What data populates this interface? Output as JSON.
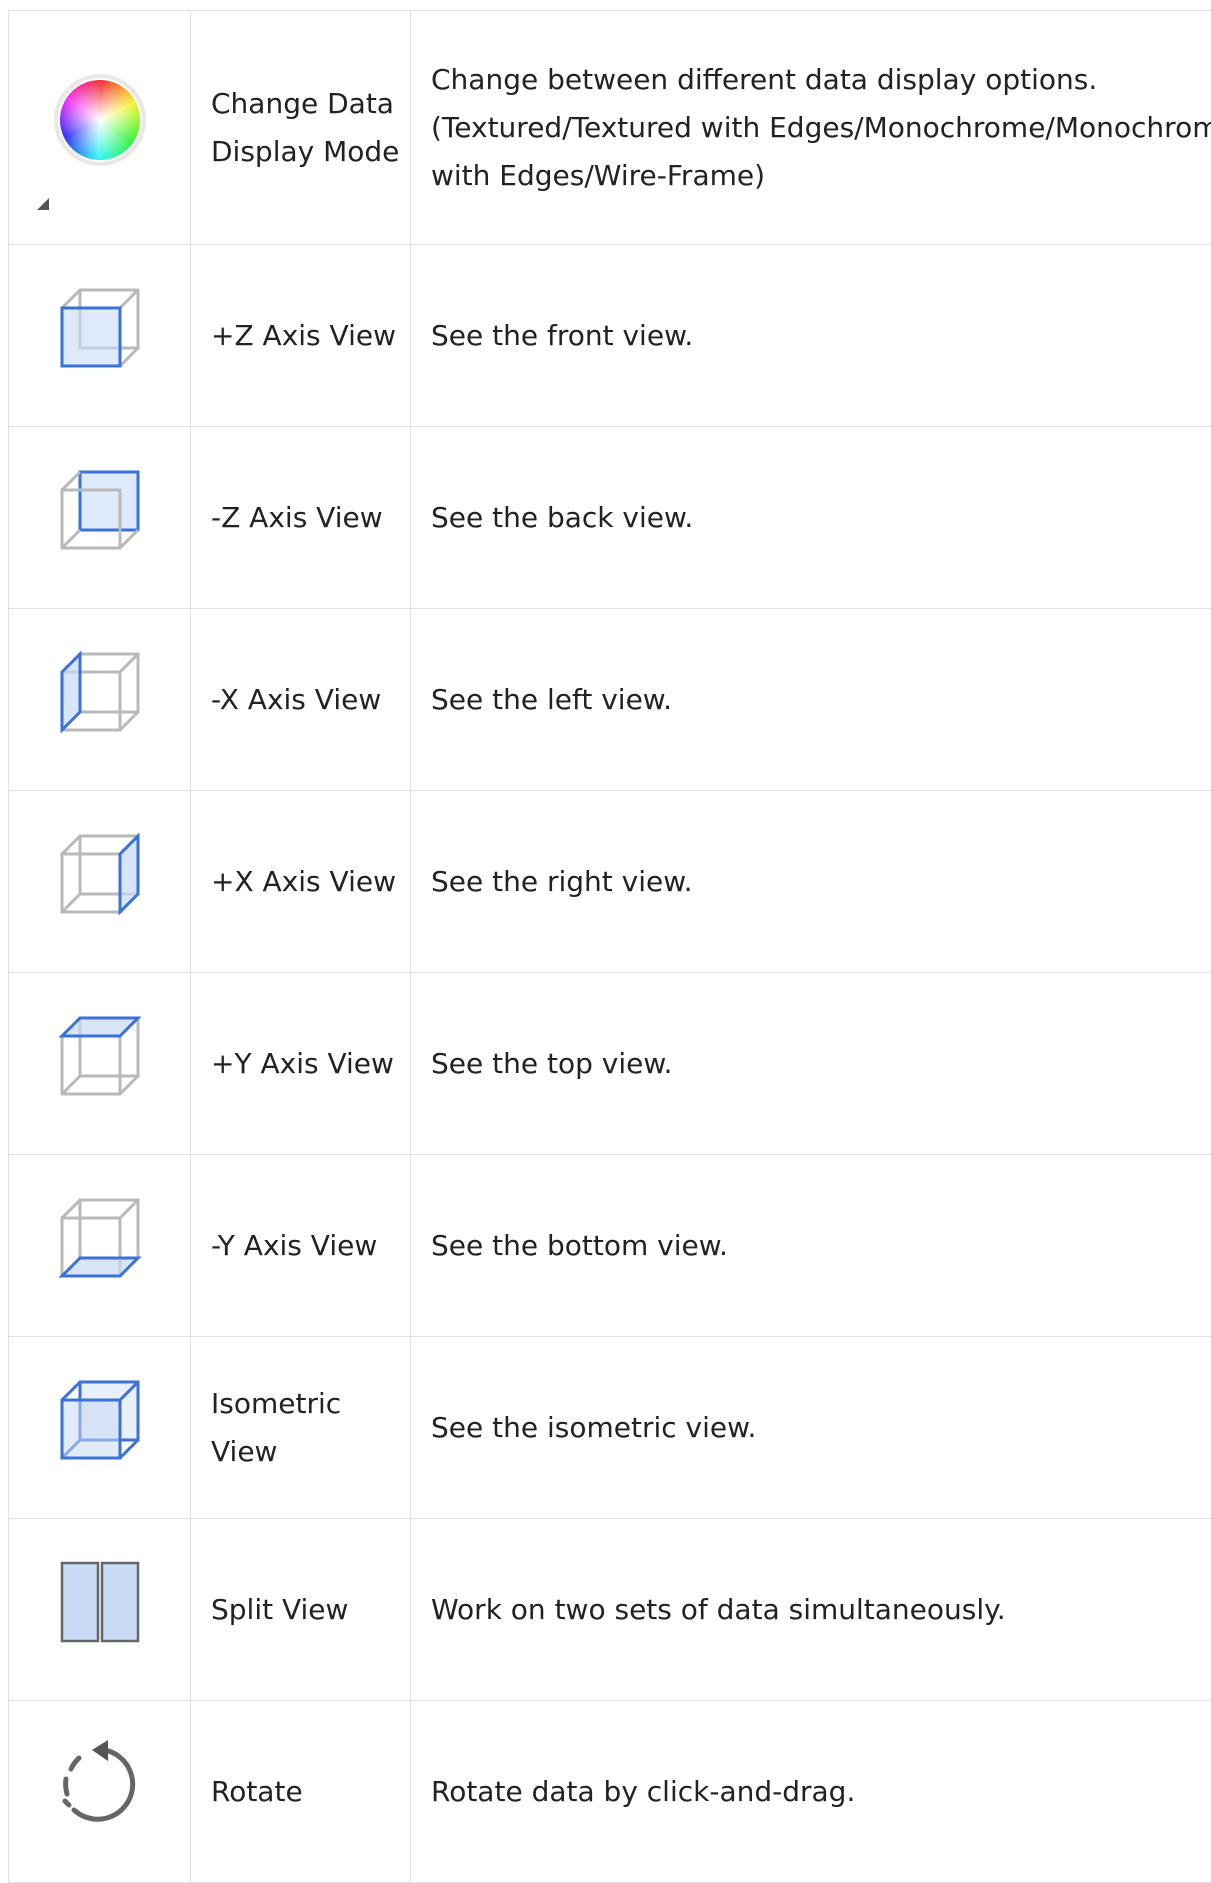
{
  "rows": [
    {
      "icon": "color-wheel-icon",
      "name": "Change Data Display Mode",
      "desc": "Change between different data display options. (Textured/Textured with Edges/Monochrome/Monochrome with Edges/Wire-Frame)"
    },
    {
      "icon": "plus-z-axis-cube-icon",
      "name": "+Z Axis View",
      "desc": "See the front view."
    },
    {
      "icon": "minus-z-axis-cube-icon",
      "name": "-Z Axis View",
      "desc": "See the back view."
    },
    {
      "icon": "minus-x-axis-cube-icon",
      "name": "-X Axis View",
      "desc": "See the left view."
    },
    {
      "icon": "plus-x-axis-cube-icon",
      "name": "+X Axis View",
      "desc": "See the right view."
    },
    {
      "icon": "plus-y-axis-cube-icon",
      "name": "+Y Axis View",
      "desc": "See the top view."
    },
    {
      "icon": "minus-y-axis-cube-icon",
      "name": "-Y Axis View",
      "desc": "See the bottom view."
    },
    {
      "icon": "isometric-cube-icon",
      "name": "Isometric View",
      "desc": "See the isometric view."
    },
    {
      "icon": "split-view-icon",
      "name": "Split View",
      "desc": "Work on two sets of data simultaneously."
    },
    {
      "icon": "rotate-icon",
      "name": "Rotate",
      "desc": "Rotate data by click-and-drag."
    }
  ],
  "colors": {
    "accent": "#3a72d6",
    "accent_fill": "#c8daf5",
    "cube_gray": "#b9b9b9",
    "border": "#e0e0e0"
  }
}
